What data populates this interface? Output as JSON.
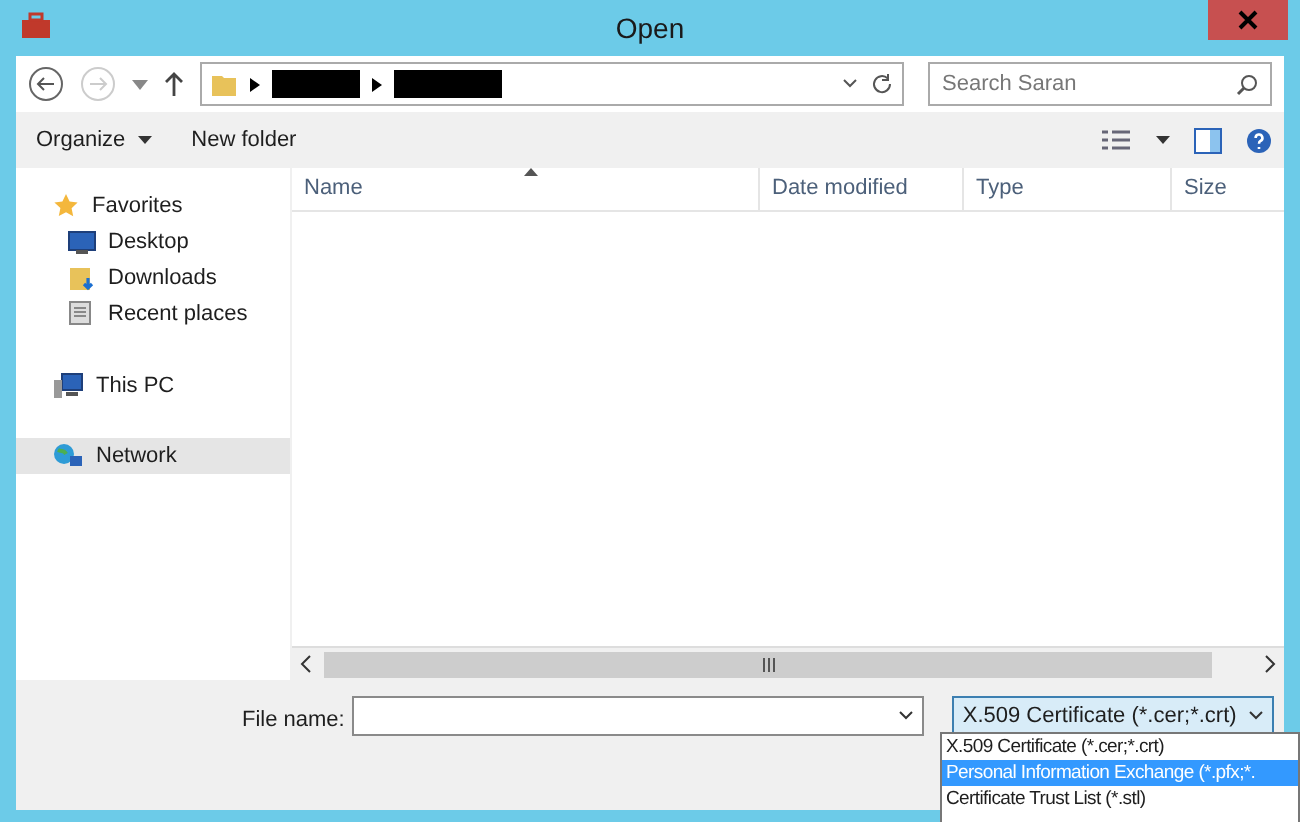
{
  "window": {
    "title": "Open"
  },
  "navigation": {
    "search": {
      "placeholder": "Search Saran"
    }
  },
  "toolbar": {
    "items": [
      "Organize",
      "New folder"
    ]
  },
  "sidebar": {
    "items": [
      {
        "label": "Favorites",
        "kind": "star",
        "selected": false,
        "children": [
          {
            "label": "Desktop",
            "kind": "desktop",
            "selected": false
          },
          {
            "label": "Downloads",
            "kind": "downloads",
            "selected": false
          },
          {
            "label": "Recent places",
            "kind": "recent",
            "selected": false
          }
        ]
      },
      {
        "label": "This PC",
        "kind": "pc",
        "selected": false
      },
      {
        "label": "Network",
        "kind": "network",
        "selected": true
      }
    ]
  },
  "table": {
    "columns": [
      "Name",
      "Date modified",
      "Type",
      "Size"
    ]
  },
  "file_name": {
    "label": "File name:"
  },
  "file_type": {
    "value": "X.509 Certificate (*.cer;*.crt)",
    "options": [
      {
        "label": "X.509 Certificate (*.cer;*.crt)",
        "highlighted": false
      },
      {
        "label": "Personal Information Exchange (*.pfx;*.",
        "highlighted": true
      },
      {
        "label": "Certificate Trust List (*.stl)",
        "highlighted": false
      }
    ]
  }
}
